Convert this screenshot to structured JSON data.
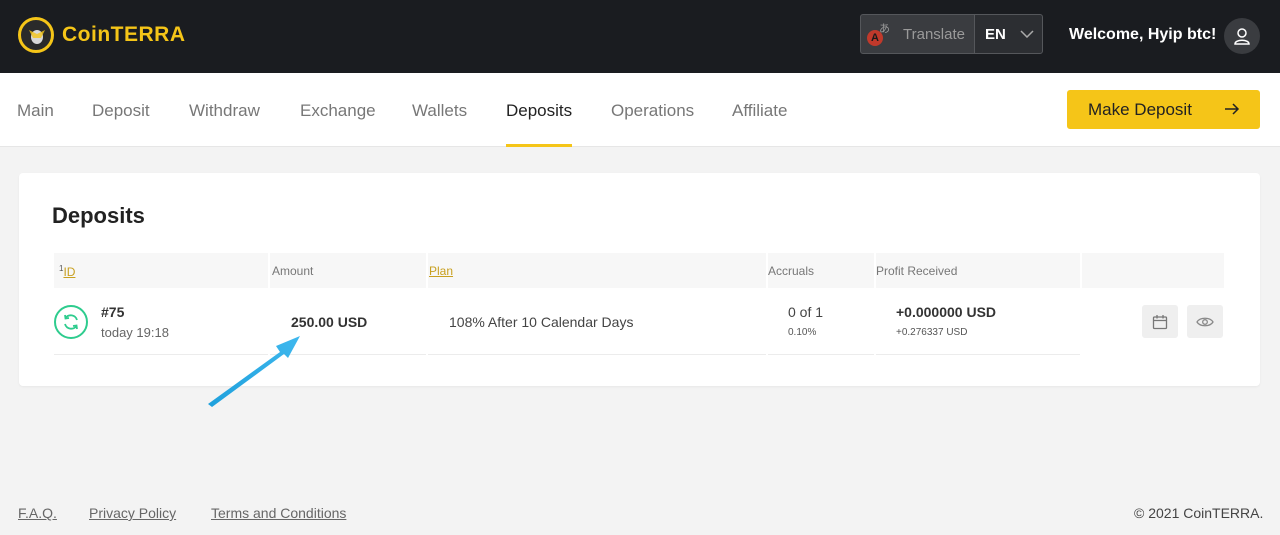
{
  "header": {
    "brand": "CoinTERRA",
    "translate_label": "Translate",
    "language": "EN",
    "welcome": "Welcome, Hyip btc!"
  },
  "nav": {
    "items": [
      {
        "label": "Main"
      },
      {
        "label": "Deposit"
      },
      {
        "label": "Withdraw"
      },
      {
        "label": "Exchange"
      },
      {
        "label": "Wallets"
      },
      {
        "label": "Deposits",
        "active": true
      },
      {
        "label": "Operations"
      },
      {
        "label": "Affiliate"
      }
    ],
    "cta_label": "Make Deposit"
  },
  "deposits": {
    "title": "Deposits",
    "columns": {
      "id_sup": "1",
      "id": "ID",
      "amount": "Amount",
      "plan": "Plan",
      "accruals": "Accruals",
      "profit": "Profit Received"
    },
    "rows": [
      {
        "id": "#75",
        "time": "today 19:18",
        "amount": "250.00 USD",
        "plan": "108% After 10 Calendar Days",
        "accruals": "0 of 1",
        "accruals_rate": "0.10%",
        "profit": "+0.000000 USD",
        "profit_expected": "+0.276337 USD"
      }
    ]
  },
  "footer": {
    "links": [
      "F.A.Q.",
      "Privacy Policy",
      "Terms and Conditions"
    ],
    "copyright": "© 2021 CoinTERRA."
  },
  "colors": {
    "accent": "#f5c518",
    "header_bg": "#1a1c20",
    "status_active": "#2ecc8e",
    "annotation_arrow": "#1ea0dc"
  },
  "icons": [
    "logo-icon",
    "translate-icon",
    "chevron-down-icon",
    "user-icon",
    "arrow-right-icon",
    "refresh-icon",
    "calendar-icon",
    "eye-icon"
  ]
}
